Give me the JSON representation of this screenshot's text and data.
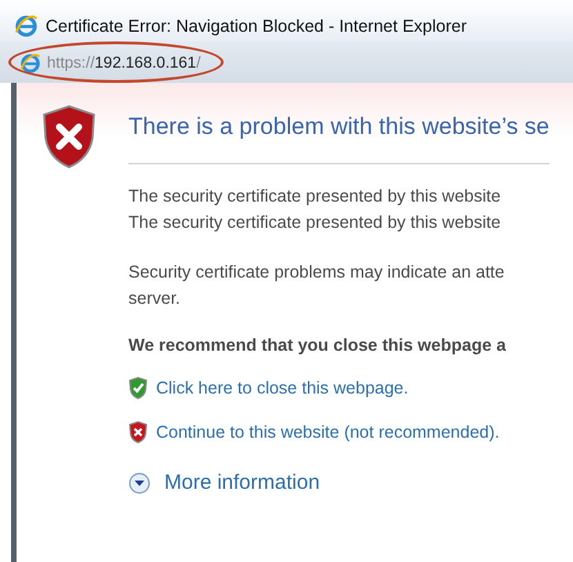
{
  "window": {
    "title": "Certificate Error: Navigation Blocked - Internet Explorer"
  },
  "address_bar": {
    "scheme": "https://",
    "host": "192.168.0.161",
    "path": "/"
  },
  "page": {
    "heading": "There is a problem with this website’s se",
    "paragraphs": [
      {
        "lines": [
          "The security certificate presented by this website",
          "The security certificate presented by this website"
        ]
      },
      {
        "lines": [
          "Security certificate problems may indicate an atte",
          "server."
        ]
      }
    ],
    "recommendation": "We recommend that you close this webpage a",
    "links": [
      {
        "kind": "safe",
        "label": "Click here to close this webpage."
      },
      {
        "kind": "unsafe",
        "label": "Continue to this website (not recommended)."
      }
    ],
    "more_info": {
      "label": "More information",
      "expanded": false
    }
  }
}
